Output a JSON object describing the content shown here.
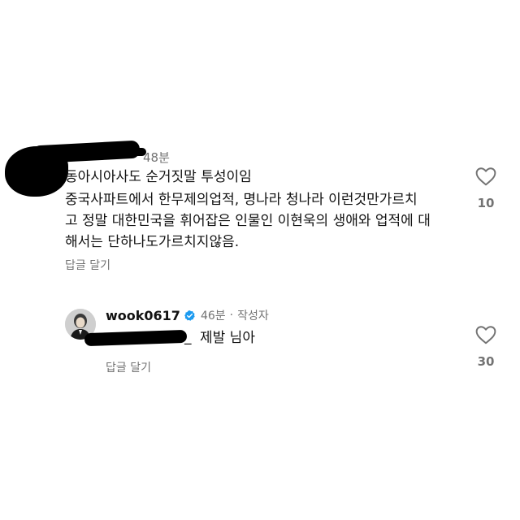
{
  "comment1": {
    "time": "48분",
    "line1": "동아시아사도 순거짓말 투성이임",
    "line2": "중국사파트에서 한무제의업적, 명나라 청나라 이런것만가르치",
    "line3": "고 정말 대한민국을 휘어잡은 인물인 이현욱의 생애와 업적에 대",
    "line4": "해서는 단하나도가르치지않음.",
    "reply_label": "답글 달기",
    "like_count": "10",
    "heart_icon": "heart-outline-icon"
  },
  "comment2": {
    "username": "wook0617",
    "verified_icon": "verified-badge-icon",
    "time": "46분",
    "separator": "·",
    "author_tag": "작성자",
    "mention_suffix": "_",
    "text": "제발 님아",
    "reply_label": "답글 달기",
    "like_count": "30",
    "heart_icon": "heart-outline-icon"
  },
  "colors": {
    "text": "#111111",
    "muted": "#737373",
    "verified": "#1d9bf0"
  }
}
